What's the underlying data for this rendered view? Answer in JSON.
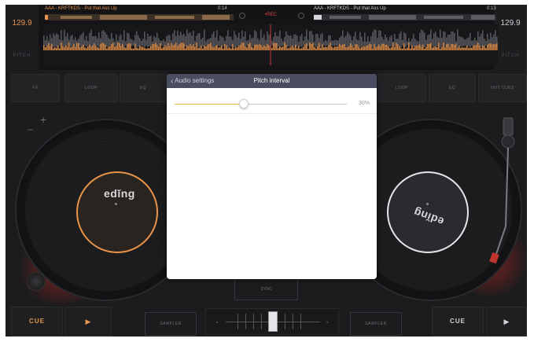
{
  "deck_left": {
    "bpm": "129.9",
    "pitch_label": "PITCH",
    "track_title": "AAA - KRFTKDS - Put that Ass Up",
    "time": "0:14",
    "cue_label": "CUE",
    "play_icon": "play-icon",
    "label_logo": "edĭng"
  },
  "deck_right": {
    "bpm": "129.9",
    "pitch_label": "PITCH",
    "track_title": "AAA - KRFTKDS - Put that Ass Up",
    "time": "0:13",
    "cue_label": "CUE",
    "play_icon": "play-icon",
    "label_logo": "edĭng"
  },
  "rec_label": "•REC",
  "pads_left": [
    "FX",
    "LOOP",
    "EQ"
  ],
  "pads_right": [
    "LOOP",
    "EQ",
    "HOT CUES"
  ],
  "sampler_label": "SAMPLER",
  "sync_label": "SYNC",
  "modal": {
    "back_label": "Audio settings",
    "title": "Pitch interval",
    "slider_value_text": "30%",
    "slider_level": 0.4
  },
  "colors": {
    "accent_orange": "#e8944a",
    "slider_fill": "#e8b24a",
    "modal_header": "#4a4c5f",
    "rec_red": "#d9413a"
  }
}
